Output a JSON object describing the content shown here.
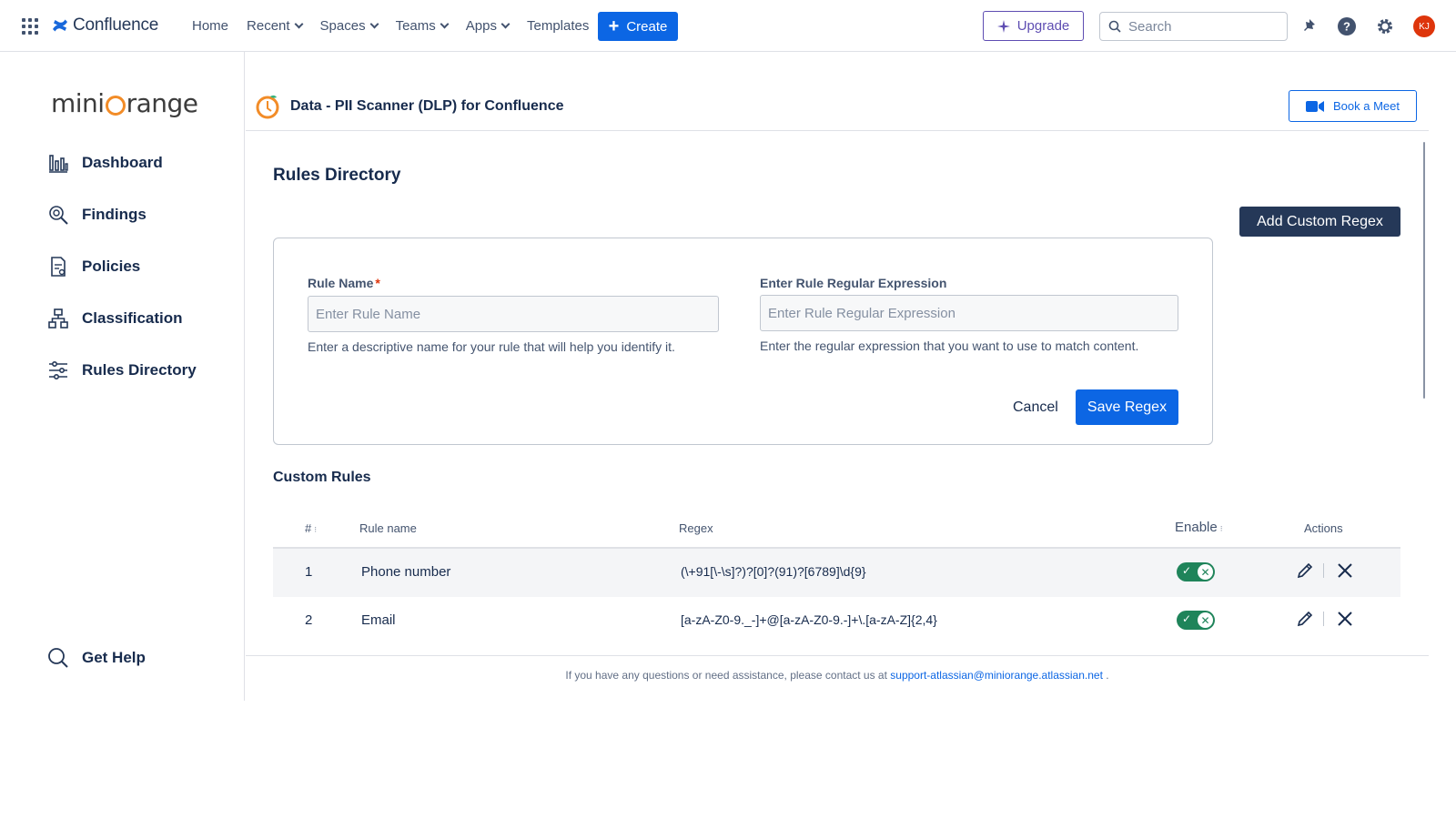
{
  "topnav": {
    "brand": "Confluence",
    "items": [
      {
        "label": "Home",
        "dropdown": false
      },
      {
        "label": "Recent",
        "dropdown": true
      },
      {
        "label": "Spaces",
        "dropdown": true
      },
      {
        "label": "Teams",
        "dropdown": true
      },
      {
        "label": "Apps",
        "dropdown": true
      },
      {
        "label": "Templates",
        "dropdown": false
      }
    ],
    "create_label": "Create",
    "upgrade_label": "Upgrade",
    "search_placeholder": "Search",
    "avatar_initials": "KJ"
  },
  "sidebar": {
    "logo_left": "mini",
    "logo_right": "range",
    "items": [
      {
        "label": "Dashboard",
        "icon": "bar-chart-icon"
      },
      {
        "label": "Findings",
        "icon": "magnifier-icon"
      },
      {
        "label": "Policies",
        "icon": "document-icon"
      },
      {
        "label": "Classification",
        "icon": "hierarchy-icon"
      },
      {
        "label": "Rules Directory",
        "icon": "sliders-icon"
      }
    ],
    "help_label": "Get Help"
  },
  "app": {
    "title": "Data - PII Scanner (DLP) for Confluence",
    "book_meet_label": "Book a Meet"
  },
  "page": {
    "heading": "Rules Directory",
    "add_custom_regex_label": "Add Custom Regex"
  },
  "form": {
    "rule_name_label": "Rule Name",
    "rule_name_placeholder": "Enter Rule Name",
    "rule_name_helper": "Enter a descriptive name for your rule that will help you identify it.",
    "regex_label": "Enter Rule Regular Expression",
    "regex_placeholder": "Enter Rule Regular Expression",
    "regex_helper": "Enter the regular expression that you want to use to match content.",
    "cancel_label": "Cancel",
    "save_label": "Save Regex"
  },
  "custom_rules": {
    "heading": "Custom Rules",
    "columns": {
      "num": "#",
      "name": "Rule name",
      "regex": "Regex",
      "enable": "Enable",
      "actions": "Actions"
    },
    "rows": [
      {
        "num": "1",
        "name": "Phone number",
        "regex": "(\\+91[\\-\\s]?)?[0]?(91)?[6789]\\d{9}",
        "enabled": true
      },
      {
        "num": "2",
        "name": "Email",
        "regex": "[a-zA-Z0-9._-]+@[a-zA-Z0-9.-]+\\.[a-zA-Z]{2,4}",
        "enabled": true
      }
    ]
  },
  "footer": {
    "text": "If you have any questions or need assistance, please contact us at",
    "email": "support-atlassian@miniorange.atlassian.net",
    "suffix": "."
  },
  "colors": {
    "primary": "#0c66e4",
    "dark_button": "#253858",
    "toggle_on": "#1f845a",
    "brand_orange": "#f28c28",
    "upgrade_purple": "#5e4db2"
  }
}
